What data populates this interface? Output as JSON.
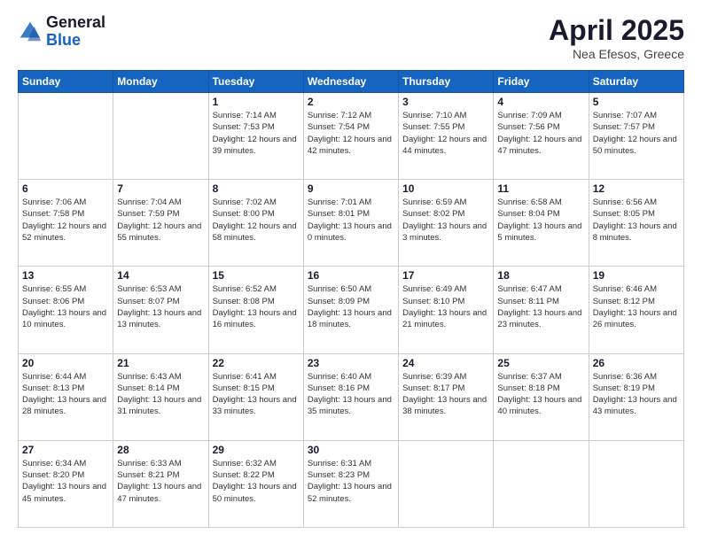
{
  "header": {
    "logo_general": "General",
    "logo_blue": "Blue",
    "month_title": "April 2025",
    "location": "Nea Efesos, Greece"
  },
  "days_of_week": [
    "Sunday",
    "Monday",
    "Tuesday",
    "Wednesday",
    "Thursday",
    "Friday",
    "Saturday"
  ],
  "weeks": [
    [
      {
        "day": "",
        "info": ""
      },
      {
        "day": "",
        "info": ""
      },
      {
        "day": "1",
        "info": "Sunrise: 7:14 AM\nSunset: 7:53 PM\nDaylight: 12 hours and 39 minutes."
      },
      {
        "day": "2",
        "info": "Sunrise: 7:12 AM\nSunset: 7:54 PM\nDaylight: 12 hours and 42 minutes."
      },
      {
        "day": "3",
        "info": "Sunrise: 7:10 AM\nSunset: 7:55 PM\nDaylight: 12 hours and 44 minutes."
      },
      {
        "day": "4",
        "info": "Sunrise: 7:09 AM\nSunset: 7:56 PM\nDaylight: 12 hours and 47 minutes."
      },
      {
        "day": "5",
        "info": "Sunrise: 7:07 AM\nSunset: 7:57 PM\nDaylight: 12 hours and 50 minutes."
      }
    ],
    [
      {
        "day": "6",
        "info": "Sunrise: 7:06 AM\nSunset: 7:58 PM\nDaylight: 12 hours and 52 minutes."
      },
      {
        "day": "7",
        "info": "Sunrise: 7:04 AM\nSunset: 7:59 PM\nDaylight: 12 hours and 55 minutes."
      },
      {
        "day": "8",
        "info": "Sunrise: 7:02 AM\nSunset: 8:00 PM\nDaylight: 12 hours and 58 minutes."
      },
      {
        "day": "9",
        "info": "Sunrise: 7:01 AM\nSunset: 8:01 PM\nDaylight: 13 hours and 0 minutes."
      },
      {
        "day": "10",
        "info": "Sunrise: 6:59 AM\nSunset: 8:02 PM\nDaylight: 13 hours and 3 minutes."
      },
      {
        "day": "11",
        "info": "Sunrise: 6:58 AM\nSunset: 8:04 PM\nDaylight: 13 hours and 5 minutes."
      },
      {
        "day": "12",
        "info": "Sunrise: 6:56 AM\nSunset: 8:05 PM\nDaylight: 13 hours and 8 minutes."
      }
    ],
    [
      {
        "day": "13",
        "info": "Sunrise: 6:55 AM\nSunset: 8:06 PM\nDaylight: 13 hours and 10 minutes."
      },
      {
        "day": "14",
        "info": "Sunrise: 6:53 AM\nSunset: 8:07 PM\nDaylight: 13 hours and 13 minutes."
      },
      {
        "day": "15",
        "info": "Sunrise: 6:52 AM\nSunset: 8:08 PM\nDaylight: 13 hours and 16 minutes."
      },
      {
        "day": "16",
        "info": "Sunrise: 6:50 AM\nSunset: 8:09 PM\nDaylight: 13 hours and 18 minutes."
      },
      {
        "day": "17",
        "info": "Sunrise: 6:49 AM\nSunset: 8:10 PM\nDaylight: 13 hours and 21 minutes."
      },
      {
        "day": "18",
        "info": "Sunrise: 6:47 AM\nSunset: 8:11 PM\nDaylight: 13 hours and 23 minutes."
      },
      {
        "day": "19",
        "info": "Sunrise: 6:46 AM\nSunset: 8:12 PM\nDaylight: 13 hours and 26 minutes."
      }
    ],
    [
      {
        "day": "20",
        "info": "Sunrise: 6:44 AM\nSunset: 8:13 PM\nDaylight: 13 hours and 28 minutes."
      },
      {
        "day": "21",
        "info": "Sunrise: 6:43 AM\nSunset: 8:14 PM\nDaylight: 13 hours and 31 minutes."
      },
      {
        "day": "22",
        "info": "Sunrise: 6:41 AM\nSunset: 8:15 PM\nDaylight: 13 hours and 33 minutes."
      },
      {
        "day": "23",
        "info": "Sunrise: 6:40 AM\nSunset: 8:16 PM\nDaylight: 13 hours and 35 minutes."
      },
      {
        "day": "24",
        "info": "Sunrise: 6:39 AM\nSunset: 8:17 PM\nDaylight: 13 hours and 38 minutes."
      },
      {
        "day": "25",
        "info": "Sunrise: 6:37 AM\nSunset: 8:18 PM\nDaylight: 13 hours and 40 minutes."
      },
      {
        "day": "26",
        "info": "Sunrise: 6:36 AM\nSunset: 8:19 PM\nDaylight: 13 hours and 43 minutes."
      }
    ],
    [
      {
        "day": "27",
        "info": "Sunrise: 6:34 AM\nSunset: 8:20 PM\nDaylight: 13 hours and 45 minutes."
      },
      {
        "day": "28",
        "info": "Sunrise: 6:33 AM\nSunset: 8:21 PM\nDaylight: 13 hours and 47 minutes."
      },
      {
        "day": "29",
        "info": "Sunrise: 6:32 AM\nSunset: 8:22 PM\nDaylight: 13 hours and 50 minutes."
      },
      {
        "day": "30",
        "info": "Sunrise: 6:31 AM\nSunset: 8:23 PM\nDaylight: 13 hours and 52 minutes."
      },
      {
        "day": "",
        "info": ""
      },
      {
        "day": "",
        "info": ""
      },
      {
        "day": "",
        "info": ""
      }
    ]
  ]
}
